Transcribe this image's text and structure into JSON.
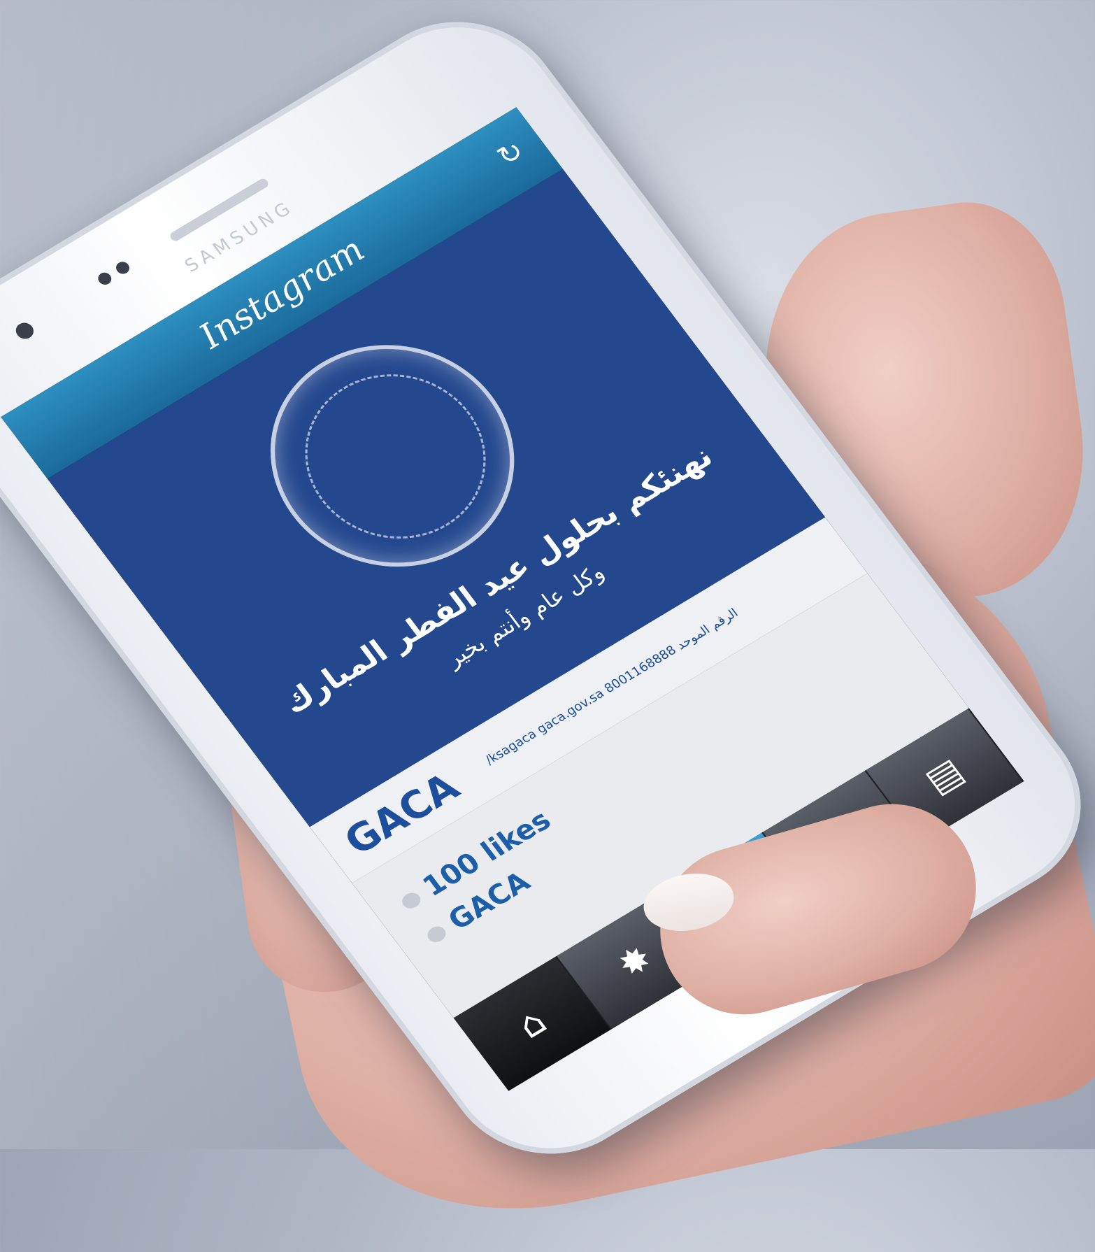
{
  "app": {
    "name": "Instagram"
  },
  "phone": {
    "brand": "SAMSUNG"
  },
  "post": {
    "greeting_line1": "نهنئكم بحلول عيد الفطر المبارك",
    "greeting_line2": "وكل عام وأنتم بخير",
    "logo_text": "GACA",
    "contact_line": "/ksagaca   gaca.gov.sa   8001168888 الرقم الموحد"
  },
  "meta": {
    "likes": "100 likes",
    "username": "GACA"
  },
  "nav": {
    "items": [
      "home",
      "explore",
      "camera",
      "activity",
      "profile"
    ],
    "active": "camera"
  },
  "colors": {
    "post_bg": "#24488e",
    "accent": "#1d5ea8",
    "ig_bar": "#2d8fc0"
  }
}
